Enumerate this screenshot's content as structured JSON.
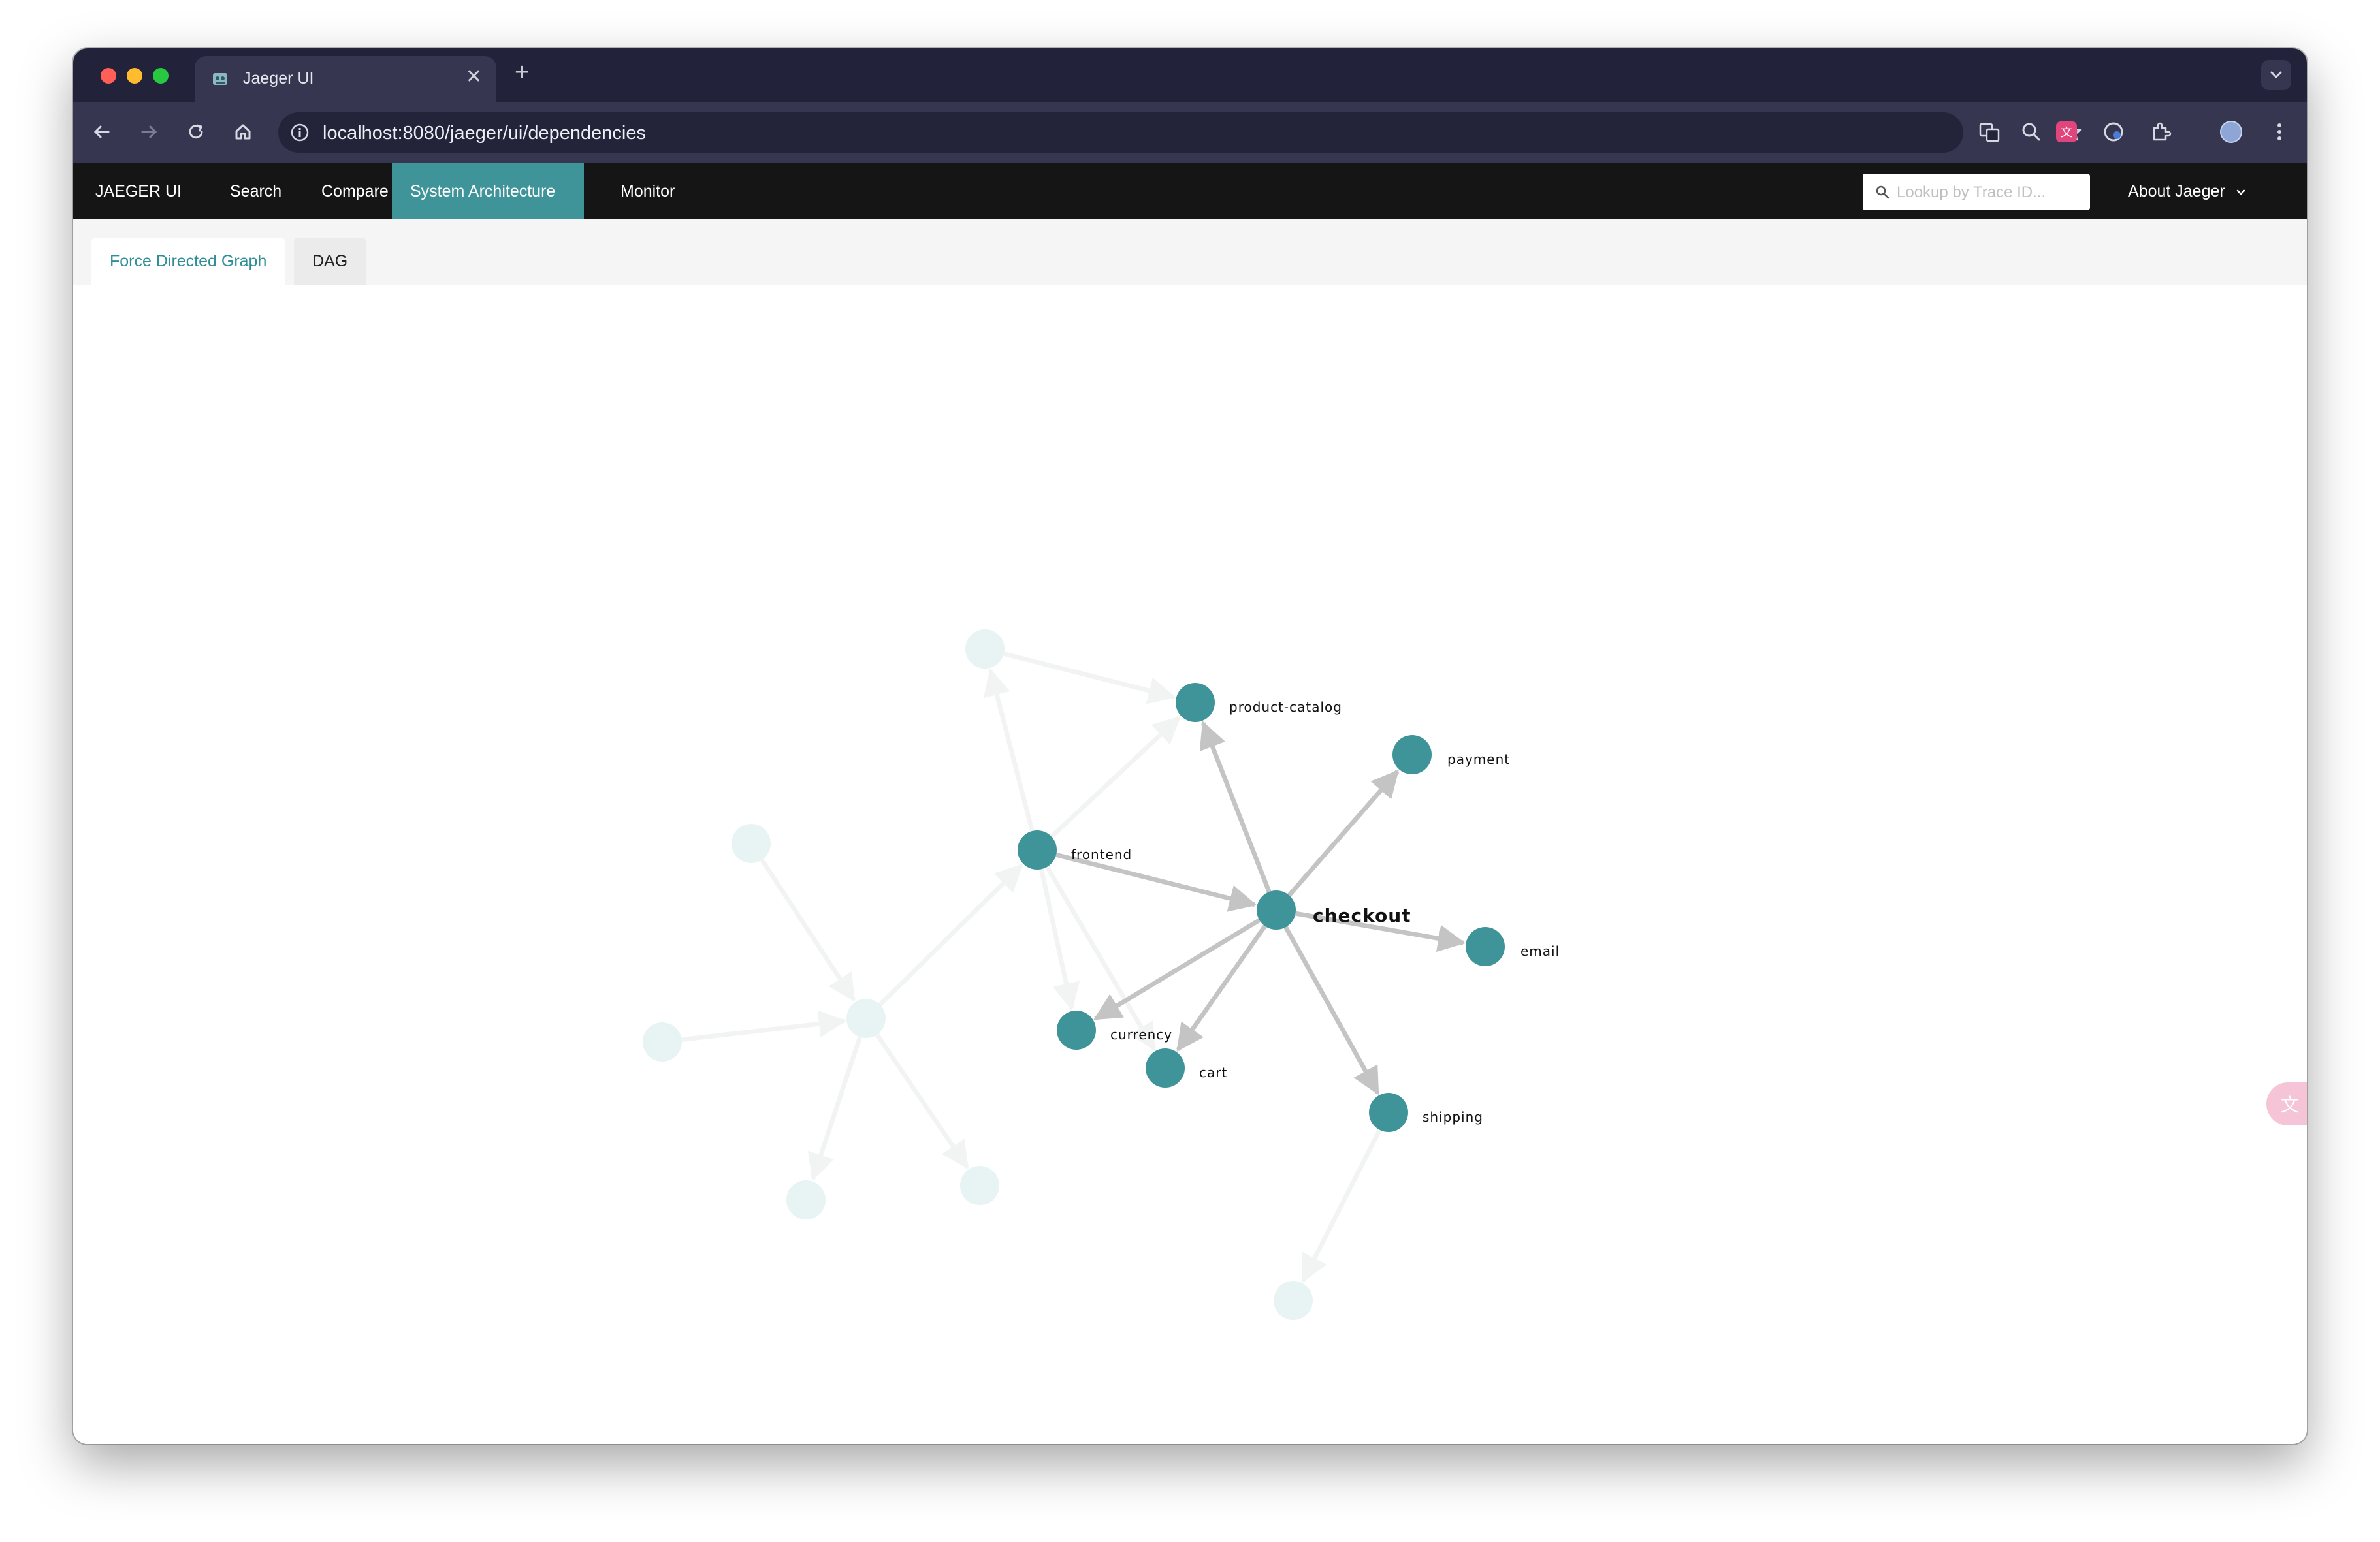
{
  "browser": {
    "tab_title": "Jaeger UI",
    "tab_close": "✕",
    "new_tab": "+",
    "url": "localhost:8080/jaeger/ui/dependencies"
  },
  "nav": {
    "brand": "JAEGER UI",
    "items": [
      "Search",
      "Compare",
      "System Architecture",
      "Monitor"
    ],
    "active_item": "System Architecture",
    "trace_lookup_placeholder": "Lookup by Trace ID...",
    "about": "About Jaeger"
  },
  "subtabs": {
    "items": [
      "Force Directed Graph",
      "DAG"
    ],
    "active": "Force Directed Graph"
  },
  "colors": {
    "node": "#3f9499",
    "node_faded": "#e8f4f4",
    "edge": "#c4c4c4",
    "edge_faded": "#f2f3f3",
    "nav_bg": "#151515",
    "active_tab_text": "#2f8f97"
  },
  "graph": {
    "focus_node": "checkout",
    "nodes": [
      {
        "id": "checkout"
      },
      {
        "id": "product-catalog"
      },
      {
        "id": "payment"
      },
      {
        "id": "frontend"
      },
      {
        "id": "email"
      },
      {
        "id": "currency"
      },
      {
        "id": "cart"
      },
      {
        "id": "shipping"
      },
      {
        "id": "f1"
      },
      {
        "id": "f2"
      },
      {
        "id": "f3"
      },
      {
        "id": "f4"
      },
      {
        "id": "f5"
      },
      {
        "id": "f6"
      },
      {
        "id": "f7"
      }
    ],
    "edges": [
      {
        "source": "frontend",
        "target": "checkout",
        "faded": false
      },
      {
        "source": "checkout",
        "target": "product-catalog",
        "faded": false
      },
      {
        "source": "checkout",
        "target": "payment",
        "faded": false
      },
      {
        "source": "checkout",
        "target": "email",
        "faded": false
      },
      {
        "source": "checkout",
        "target": "currency",
        "faded": false
      },
      {
        "source": "checkout",
        "target": "cart",
        "faded": false
      },
      {
        "source": "checkout",
        "target": "shipping",
        "faded": false
      },
      {
        "source": "f1",
        "target": "product-catalog",
        "faded": true
      },
      {
        "source": "frontend",
        "target": "f1",
        "faded": true
      },
      {
        "source": "frontend",
        "target": "product-catalog",
        "faded": true
      },
      {
        "source": "frontend",
        "target": "currency",
        "faded": true
      },
      {
        "source": "frontend",
        "target": "cart",
        "faded": true
      },
      {
        "source": "f4",
        "target": "frontend",
        "faded": true
      },
      {
        "source": "f2",
        "target": "f4",
        "faded": true
      },
      {
        "source": "f3",
        "target": "f4",
        "faded": true
      },
      {
        "source": "f4",
        "target": "f5",
        "faded": true
      },
      {
        "source": "f4",
        "target": "f6",
        "faded": true
      },
      {
        "source": "shipping",
        "target": "f7",
        "faded": true
      }
    ]
  }
}
